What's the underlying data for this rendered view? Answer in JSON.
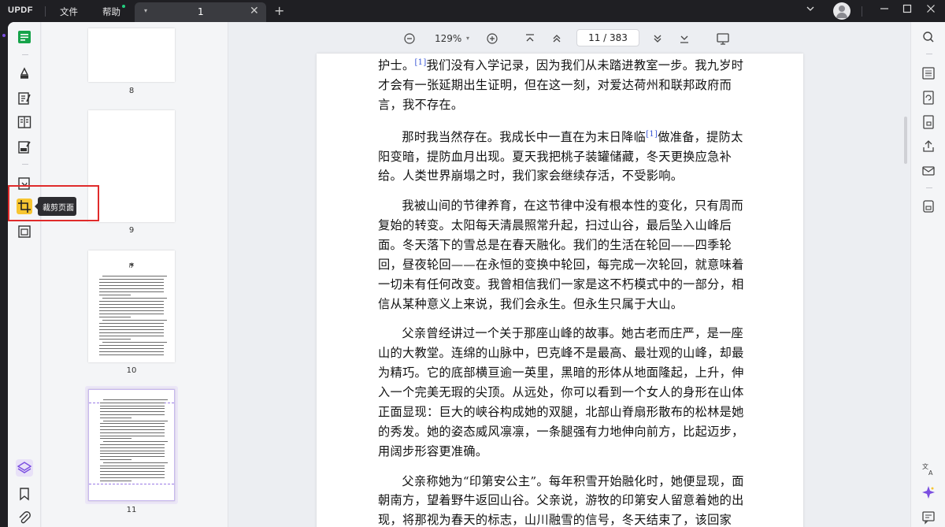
{
  "app": {
    "logo": "UPDF"
  },
  "menu": {
    "file": "文件",
    "help": "帮助"
  },
  "tab": {
    "label": "1",
    "close": "✕",
    "add": "+"
  },
  "window_controls": {
    "dropdown": "⌄",
    "minimize": "—",
    "maximize": "☐",
    "close": "✕"
  },
  "toolbar": {
    "zoom": "129%",
    "zoom_caret": "▾",
    "page": "11  /  383"
  },
  "tooltip": {
    "label": "裁剪页面"
  },
  "thumbnails": [
    {
      "number": "8"
    },
    {
      "number": "9"
    },
    {
      "number": "10",
      "heading": "序"
    },
    {
      "number": "11"
    }
  ],
  "document": {
    "paragraphs": [
      {
        "pre": "护士。",
        "sup": "[1]",
        "post": "我们没有入学记录，因为我们从未踏进教室一步。我九岁时才会有一张延期出生证明，但在这一刻，对爱达荷州和联邦政府而言，我不存在。"
      },
      {
        "pre": "那时我当然存在。我成长中一直在为末日降临",
        "sup": "[1]",
        "post": "做准备，提防太阳变暗，提防血月出现。夏天我把桃子装罐储藏，冬天更换应急补给。人类世界崩塌之时，我们家会继续存活，不受影响。"
      },
      {
        "pre": "我被山间的节律养育，在这节律中没有根本性的变化，只有周而复始的转变。太阳每天清晨照常升起，扫过山谷，最后坠入山峰后面。冬天落下的雪总是在春天融化。我们的生活在轮回——四季轮回，昼夜轮回——在永恒的变换中轮回，每完成一次轮回，就意味着一切未有任何改变。我曾相信我们一家是这不朽模式中的一部分，相信从某种意义上来说，我们会永生。但永生只属于大山。",
        "sup": "",
        "post": ""
      },
      {
        "pre": "父亲曾经讲过一个关于那座山峰的故事。她古老而庄严，是一座山的大教堂。连绵的山脉中，巴克峰不是最高、最壮观的山峰，却最为精巧。它的底部横亘逾一英里，黑暗的形体从地面隆起，上升，伸入一个完美无瑕的尖顶。从远处，你可以看到一个女人的身形在山体正面显现：巨大的峡谷构成她的双腿，北部山脊扇形散布的松林是她的秀发。她的姿态威风凛凛，一条腿强有力地伸向前方，比起迈步，用阔步形容更准确。",
        "sup": "",
        "post": ""
      },
      {
        "pre": "父亲称她为“印第安公主”。每年积雪开始融化时，她便显现，面朝南方，望着野牛返回山谷。父亲说，游牧的印第安人留意着她的出现，将那视为春天的标志，山川融雪的信号，冬天结束了，该回家",
        "sup": "",
        "post": ""
      }
    ]
  },
  "colors": {
    "accent": "#7b4fe0",
    "highlight": "#f7c531",
    "red_box": "#e02b2b",
    "link": "#3a57d6"
  }
}
